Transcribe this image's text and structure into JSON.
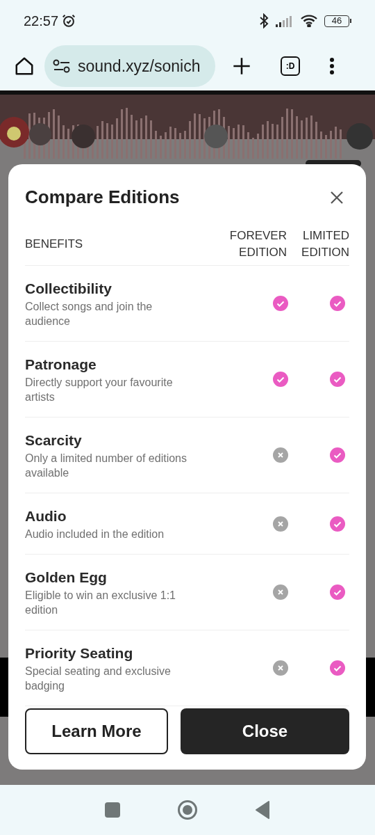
{
  "status_bar": {
    "time": "22:57",
    "battery": "46"
  },
  "browser": {
    "url": "sound.xyz/sonich",
    "tab_button": ":D"
  },
  "modal": {
    "title": "Compare Editions",
    "columns": [
      "BENEFITS",
      "FOREVER EDITION",
      "LIMITED EDITION"
    ],
    "rows": [
      {
        "name": "Collectibility",
        "description": "Collect songs and join the audience",
        "forever": true,
        "limited": true
      },
      {
        "name": "Patronage",
        "description": "Directly support your favourite artists",
        "forever": true,
        "limited": true
      },
      {
        "name": "Scarcity",
        "description": "Only a limited number of editions available",
        "forever": false,
        "limited": true
      },
      {
        "name": "Audio",
        "description": "Audio included in the edition",
        "forever": false,
        "limited": true
      },
      {
        "name": "Golden Egg",
        "description": "Eligible to win an exclusive 1:1 edition",
        "forever": false,
        "limited": true
      },
      {
        "name": "Priority Seating",
        "description": "Special seating and exclusive badging",
        "forever": false,
        "limited": true
      }
    ],
    "buttons": [
      {
        "label": "Learn More",
        "kind": "outline"
      },
      {
        "label": "Close",
        "kind": "filled"
      }
    ]
  }
}
